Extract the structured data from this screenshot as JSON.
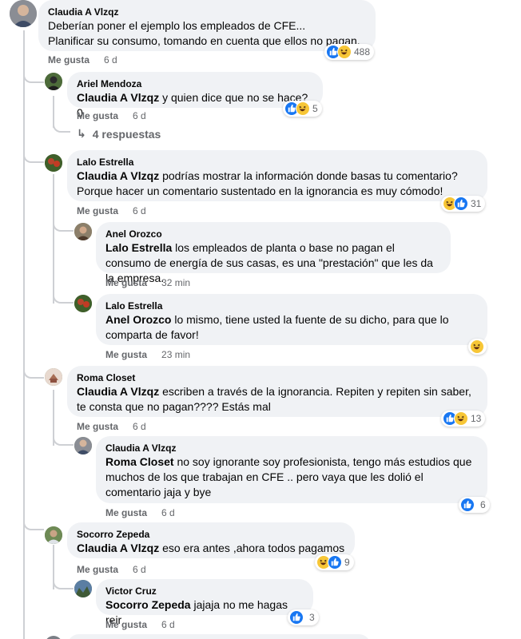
{
  "comments": [
    {
      "name": "Claudia A Vlzqz",
      "mention": "",
      "text_lines": [
        "Deberían poner el ejemplo los empleados de CFE...",
        "Planificar su consumo, tomando en cuenta que ellos no pagan."
      ],
      "like": "Me gusta",
      "time": "6 d",
      "reaction_count": "488",
      "reactions": [
        "like",
        "haha"
      ]
    },
    {
      "name": "Ariel Mendoza",
      "mention": "Claudia A Vlzqz",
      "text": "y quien dice que no se hace?0",
      "like": "Me gusta",
      "time": "6 d",
      "reaction_count": "5",
      "reactions": [
        "like",
        "haha"
      ]
    },
    {
      "name": "Lalo Estrella",
      "mention": "Claudia A Vlzqz",
      "text": "podrías mostrar la información donde basas tu comentario? Porque hacer un comentario sustentado en la ignorancia es muy cómodo!",
      "like": "Me gusta",
      "time": "6 d",
      "reaction_count": "31",
      "reactions": [
        "haha",
        "like"
      ]
    },
    {
      "name": "Anel Orozco",
      "mention": "Lalo Estrella",
      "text": "los empleados de planta o base no pagan el consumo de energía de sus casas, es una \"prestación\" que les da la empresa.",
      "like": "Me gusta",
      "time": "32 min"
    },
    {
      "name": "Lalo Estrella",
      "mention": "Anel Orozco",
      "text": "lo mismo, tiene usted la fuente de su dicho, para que lo comparta de favor!",
      "like": "Me gusta",
      "time": "23 min",
      "reactions": [
        "haha"
      ]
    },
    {
      "name": "Roma Closet",
      "mention": "Claudia A Vlzqz",
      "text": "escriben a través de la ignorancia. Repiten y repiten sin saber, te consta que no pagan???? Estás mal",
      "like": "Me gusta",
      "time": "6 d",
      "reaction_count": "13",
      "reactions": [
        "like",
        "haha"
      ]
    },
    {
      "name": "Claudia A Vlzqz",
      "mention": "Roma Closet",
      "text": "no soy ignorante soy profesionista, tengo más estudios que muchos de los que trabajan en CFE .. pero vaya que les dolió el comentario jaja y bye",
      "like": "Me gusta",
      "time": "6 d",
      "reaction_count": "6",
      "reactions": [
        "like"
      ]
    },
    {
      "name": "Socorro Zepeda",
      "mention": "Claudia A Vlzqz",
      "text": "eso era antes ,ahora todos pagamos",
      "like": "Me gusta",
      "time": "6 d",
      "reaction_count": "9",
      "reactions": [
        "haha",
        "like"
      ]
    },
    {
      "name": "Victor Cruz",
      "mention": "Socorro Zepeda",
      "text": "jajaja no me hagas reir",
      "like": "Me gusta",
      "time": "6 d",
      "reaction_count": "3",
      "reactions": [
        "like"
      ]
    }
  ],
  "replies_link": "4 respuestas",
  "colors": {
    "like": "#1877f2",
    "haha": "#f7c636",
    "bubble": "#f0f2f5",
    "meta": "#65676b"
  },
  "icons": {
    "like": "thumbs-up-icon",
    "haha": "laughing-face-icon",
    "reply_arrow": "reply-arrow-icon"
  }
}
